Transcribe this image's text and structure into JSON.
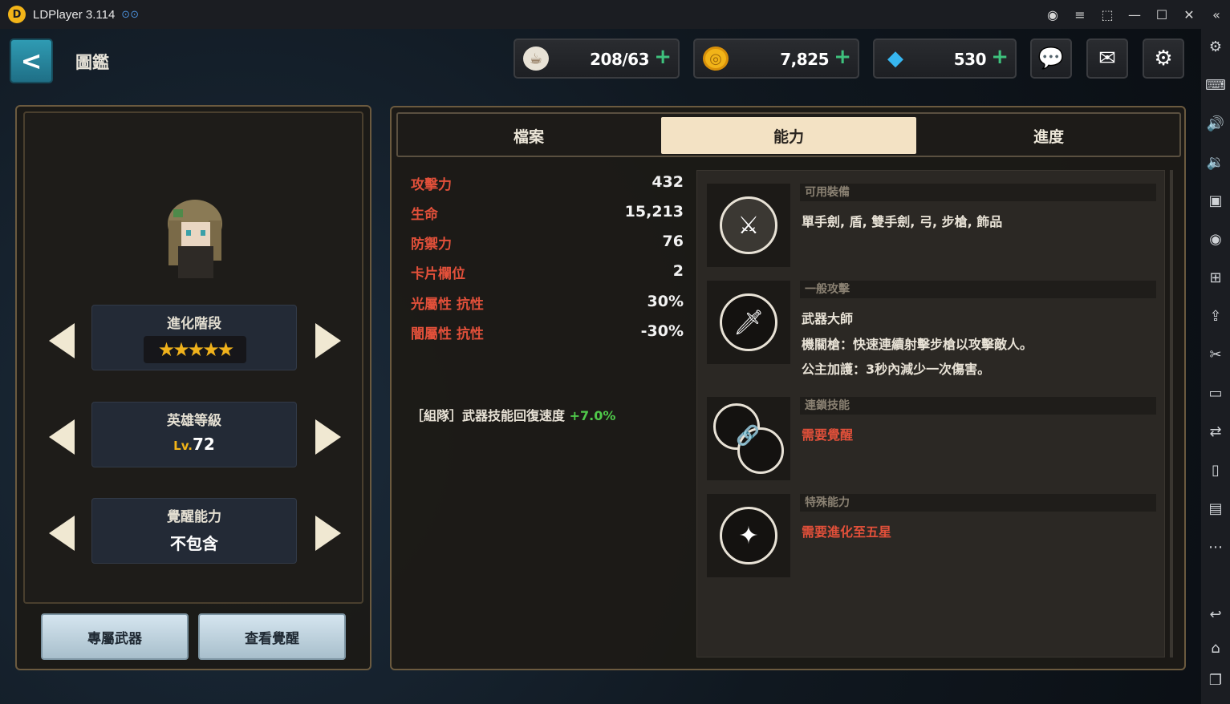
{
  "titlebar": {
    "app_title": "LDPlayer 3.114",
    "controls": [
      "account-icon",
      "menu-icon",
      "expand-icon",
      "minimize-icon",
      "maximize-icon",
      "close-icon",
      "collapse-icon"
    ]
  },
  "sidebar": {
    "icons": [
      "settings-icon",
      "keyboard-icon",
      "volume-up-icon",
      "volume-down-icon",
      "screenshot-icon",
      "record-icon",
      "add-window-icon",
      "apk-install-icon",
      "scissors-icon",
      "video-icon",
      "sync-icon",
      "shake-icon",
      "screen-icon",
      "more-icon",
      "back-icon",
      "home-icon",
      "recent-apps-icon"
    ]
  },
  "header": {
    "back_label": "<",
    "title": "圖鑑",
    "resources": [
      {
        "icon": "coffee-icon",
        "value": "208/63"
      },
      {
        "icon": "coin-icon",
        "value": "7,825"
      },
      {
        "icon": "gem-icon",
        "value": "530"
      }
    ],
    "plus_label": "+",
    "buttons": [
      "chat-icon",
      "mail-icon",
      "settings-icon"
    ]
  },
  "left": {
    "selectors": [
      {
        "label": "進化階段",
        "value": "★★★★★",
        "stars": 5
      },
      {
        "label": "英雄等級",
        "value_prefix": "Lv.",
        "value": "72"
      },
      {
        "label": "覺醒能力",
        "value": "不包含"
      }
    ],
    "buttons": [
      "專屬武器",
      "查看覺醒"
    ]
  },
  "tabs": {
    "items": [
      "檔案",
      "能力",
      "進度"
    ],
    "active_index": 1
  },
  "stats": [
    {
      "name": "攻擊力",
      "value": "432"
    },
    {
      "name": "生命",
      "value": "15,213"
    },
    {
      "name": "防禦力",
      "value": "76"
    },
    {
      "name": "卡片欄位",
      "value": "2"
    },
    {
      "name": "光屬性 抗性",
      "value": "30%"
    },
    {
      "name": "闇屬性 抗性",
      "value": "-30%"
    }
  ],
  "party_bonus": {
    "label": "［組隊］武器技能回復速度",
    "value": "+7.0%"
  },
  "skills": [
    {
      "icon": "sword-shield-icon",
      "header": "可用裝備",
      "lines": [
        "單手劍, 盾, 雙手劍, 弓, 步槍, 飾品"
      ]
    },
    {
      "icon": "sword-icon",
      "header": "一般攻擊",
      "title": "武器大師",
      "lines": [
        "機關槍：快速連續射擊步槍以攻擊敵人。",
        "公主加護：3秒內減少一次傷害。"
      ]
    },
    {
      "icon": "chain-icon",
      "header": "連鎖技能",
      "lines": [
        "需要覺醒"
      ]
    },
    {
      "icon": "sparkle-icon",
      "header": "特殊能力",
      "lines": [
        "需要進化至五星"
      ]
    }
  ]
}
